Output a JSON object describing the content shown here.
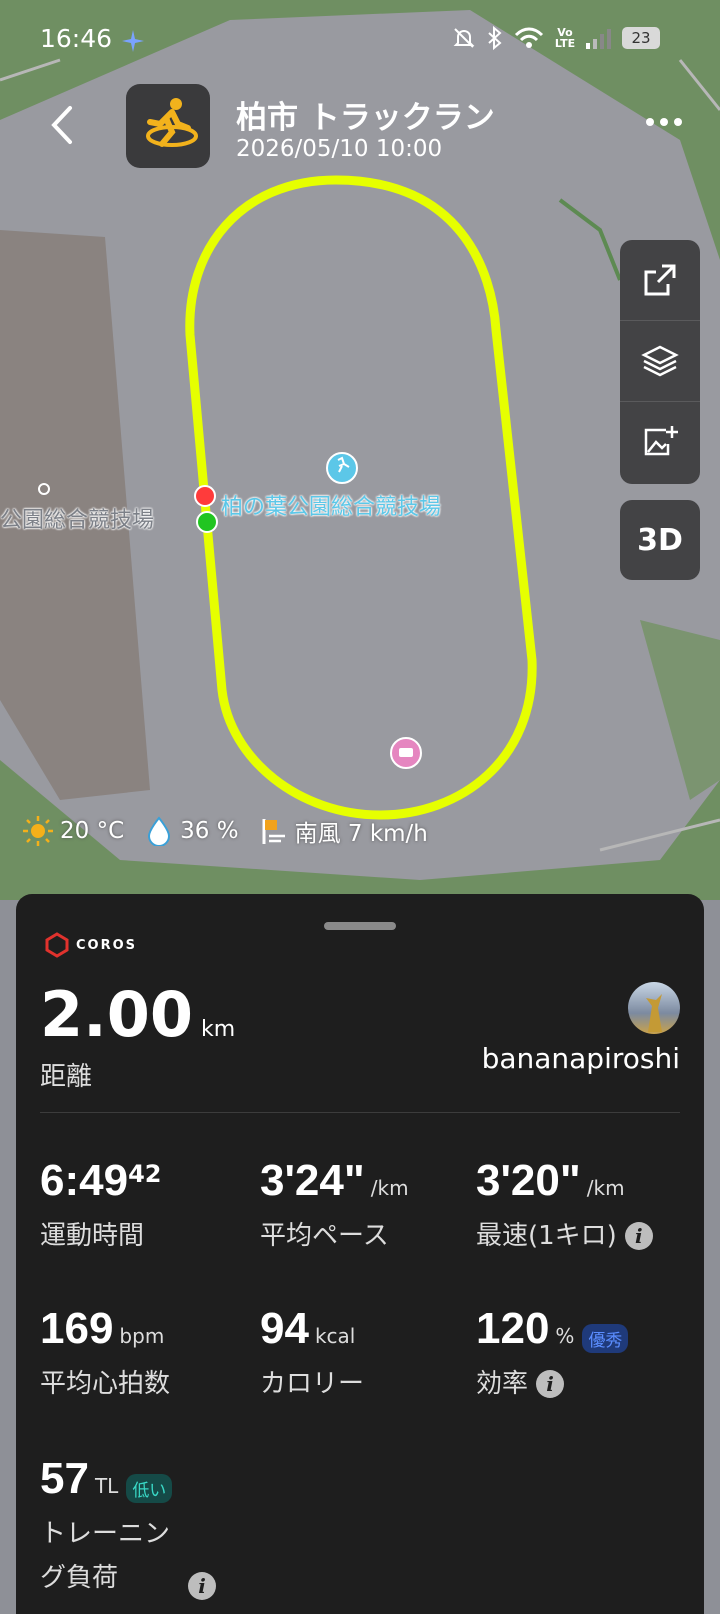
{
  "status_bar": {
    "time": "16:46",
    "volte": "Vo LTE",
    "battery": "23"
  },
  "header": {
    "title": "柏市 トラックラン",
    "datetime": "2026/05/10 10:00"
  },
  "map": {
    "venue_label": "柏の葉公園総合競技場",
    "venue_label_partial": "公園総合競技場"
  },
  "tools": {
    "mode_3d": "3D"
  },
  "weather": {
    "temperature": "20 °C",
    "humidity": "36 %",
    "wind": "南風 7 km/h"
  },
  "panel": {
    "brand": "COROS",
    "distance": {
      "value": "2.00",
      "unit": "km",
      "label": "距離"
    },
    "user": {
      "name": "bananapiroshi"
    },
    "stats": {
      "time": {
        "main": "6:49",
        "sup": "42",
        "label": "運動時間"
      },
      "avg_pace": {
        "value": "3'24\"",
        "unit": "/km",
        "label": "平均ペース"
      },
      "best_pace": {
        "value": "3'20\"",
        "unit": "/km",
        "label": "最速(1キロ)"
      },
      "heart_rate": {
        "value": "169",
        "unit": "bpm",
        "label": "平均心拍数"
      },
      "calories": {
        "value": "94",
        "unit": "kcal",
        "label": "カロリー"
      },
      "efficiency": {
        "value": "120",
        "unit": "%",
        "badge": "優秀",
        "label": "効率"
      },
      "training_load": {
        "value": "57",
        "unit": "TL",
        "badge": "低い",
        "label": "トレーニング負荷"
      }
    }
  }
}
